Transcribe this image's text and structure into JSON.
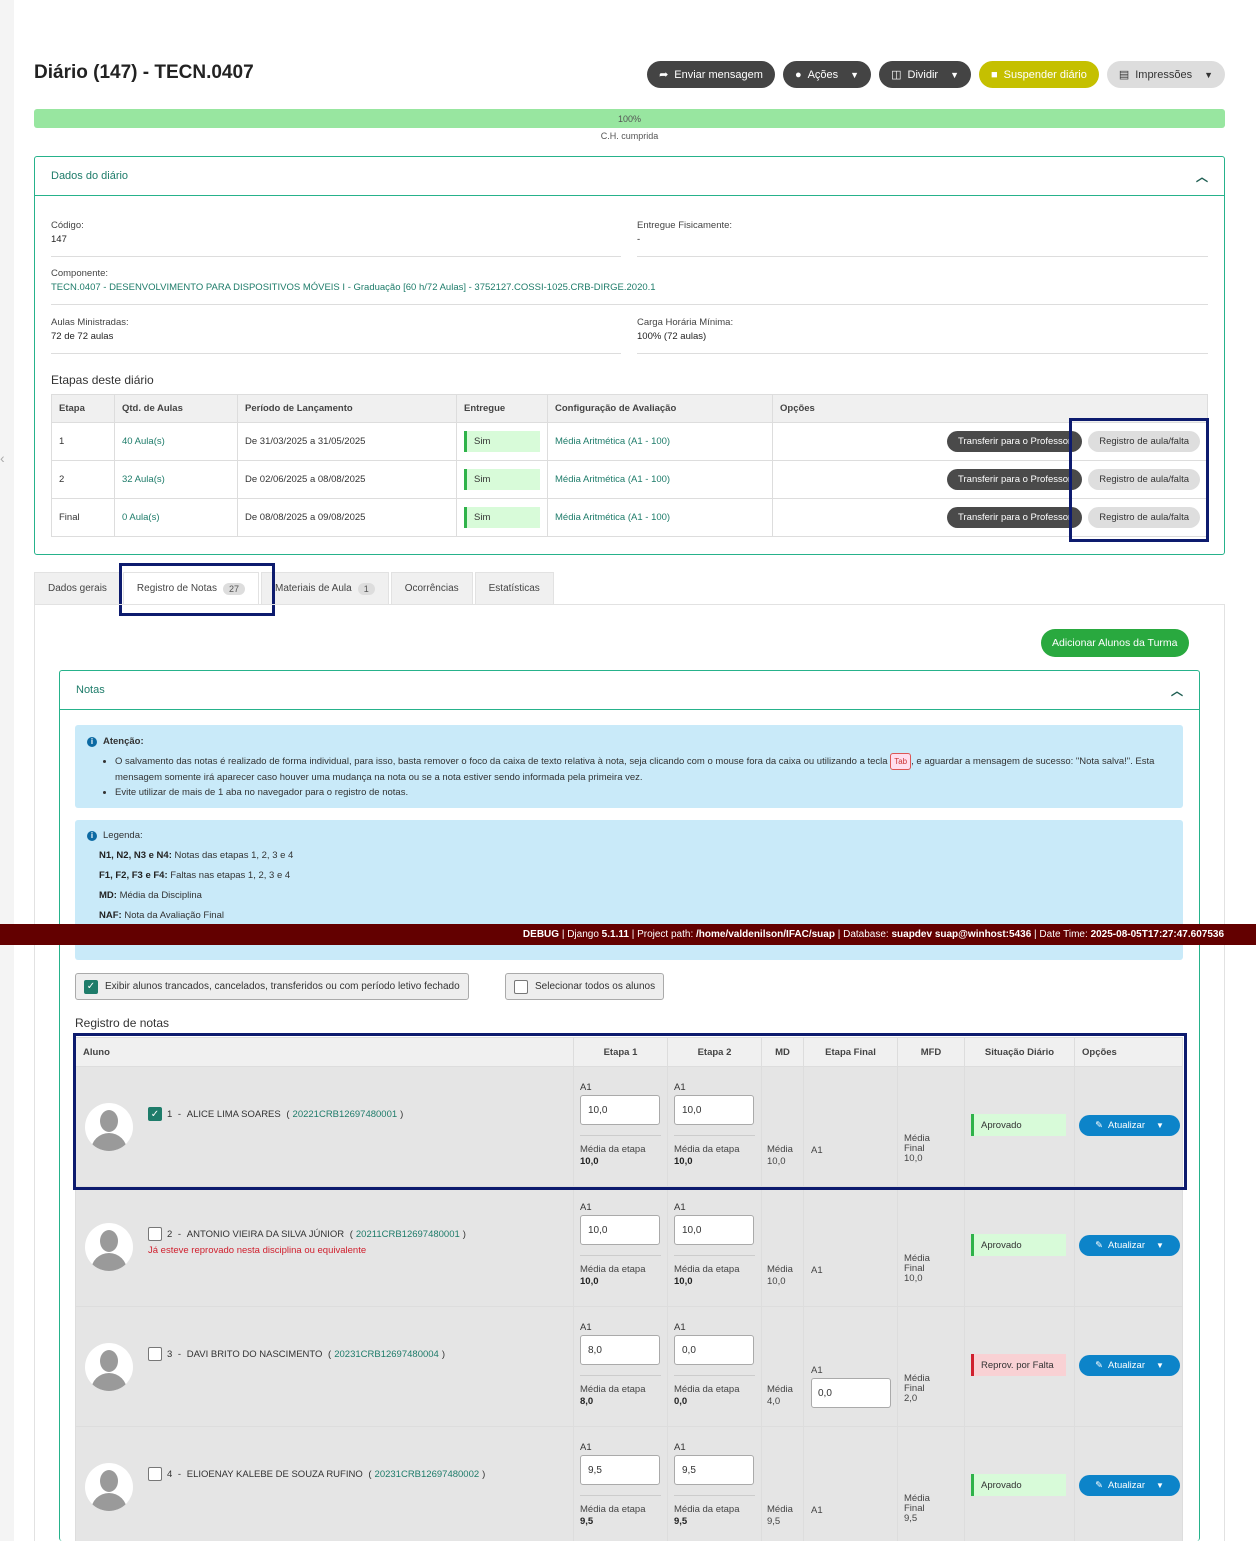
{
  "page_title": "Diário (147) - TECN.0407",
  "actions": {
    "enviar": "Enviar mensagem",
    "acoes": "Ações",
    "dividir": "Dividir",
    "suspender": "Suspender diário",
    "impressoes": "Impressões"
  },
  "progress": {
    "label": "100%",
    "caption": "C.H. cumprida",
    "value": 1.0
  },
  "dados": {
    "header": "Dados do diário",
    "codigo_label": "Código:",
    "codigo": "147",
    "entregue_label": "Entregue Fisicamente:",
    "entregue": "-",
    "componente_label": "Componente:",
    "componente": "TECN.0407 - DESENVOLVIMENTO PARA DISPOSITIVOS MÓVEIS I - Graduação [60 h/72 Aulas] - 3752127.COSSI-1025.CRB-DIRGE.2020.1",
    "aulas_label": "Aulas Ministradas:",
    "aulas": "72 de 72 aulas",
    "carga_label": "Carga Horária Mínima:",
    "carga": "100% (72 aulas)"
  },
  "etapas": {
    "title": "Etapas deste diário",
    "headers": [
      "Etapa",
      "Qtd. de Aulas",
      "Período de Lançamento",
      "Entregue",
      "Configuração de Avaliação",
      "Opções"
    ],
    "btn_transferir": "Transferir para o Professor",
    "btn_registro": "Registro de aula/falta",
    "rows": [
      {
        "etapa": "1",
        "qtd": "40 Aula(s)",
        "periodo": "De 31/03/2025 a 31/05/2025",
        "entregue": "Sim",
        "config": "Média Aritmética (A1 - 100)"
      },
      {
        "etapa": "2",
        "qtd": "32 Aula(s)",
        "periodo": "De 02/06/2025 a 08/08/2025",
        "entregue": "Sim",
        "config": "Média Aritmética (A1 - 100)"
      },
      {
        "etapa": "Final",
        "qtd": "0 Aula(s)",
        "periodo": "De 08/08/2025 a 09/08/2025",
        "entregue": "Sim",
        "config": "Média Aritmética (A1 - 100)"
      }
    ]
  },
  "tabs": [
    {
      "label": "Dados gerais",
      "count": ""
    },
    {
      "label": "Registro de Notas",
      "count": "27"
    },
    {
      "label": "Materiais de Aula",
      "count": "1"
    },
    {
      "label": "Ocorrências",
      "count": ""
    },
    {
      "label": "Estatísticas",
      "count": ""
    }
  ],
  "add_alunos": "Adicionar Alunos da Turma",
  "notas_header": "Notas",
  "atencao": {
    "title": "Atenção:",
    "item1_a": "O salvamento das notas é realizado de forma individual, para isso, basta remover o foco da caixa de texto relativa à nota, seja clicando com o mouse fora da caixa ou utilizando a tecla",
    "tab_key": "Tab",
    "item1_b": ", e aguardar a mensagem de sucesso: \"Nota salva!\". Esta mensagem somente irá aparecer caso houver uma mudança na nota ou se a nota estiver sendo informada pela primeira vez.",
    "item2": "Evite utilizar de mais de 1 aba no navegador para o registro de notas."
  },
  "legenda": {
    "title": "Legenda:",
    "items": [
      {
        "k": "N1, N2, N3 e N4:",
        "v": "Notas das etapas 1, 2, 3 e 4"
      },
      {
        "k": "F1, F2, F3 e F4:",
        "v": "Faltas nas etapas 1, 2, 3 e 4"
      },
      {
        "k": "MD:",
        "v": "Média da Disciplina"
      },
      {
        "k": "NAF:",
        "v": "Nota da Avaliação Final"
      }
    ]
  },
  "debug": {
    "a": "DEBUG",
    "b": " | Django ",
    "c": "5.1.11",
    "d": " | Project path: ",
    "e": "/home/valdenilson/IFAC/suap",
    "f": " | Database: ",
    "g": "suapdev suap@winhost:5436",
    "h": " | Date Time: ",
    "i": "2025-08-05T17:27:47.607536"
  },
  "chk_exibir": "Exibir alunos trancados, cancelados, transferidos ou com período letivo fechado",
  "chk_selecionar": "Selecionar todos os alunos",
  "registro_title": "Registro de notas",
  "notas_headers": [
    "Aluno",
    "Etapa 1",
    "Etapa 2",
    "MD",
    "Etapa Final",
    "MFD",
    "Situação Diário",
    "Opções"
  ],
  "labels": {
    "a1": "A1",
    "media_etapa": "Média da etapa",
    "media": "Média",
    "media_final_1": "Média",
    "media_final_2": "Final",
    "atualizar": "Atualizar"
  },
  "alunos": [
    {
      "num": "1",
      "nome": "ALICE LIMA SOARES",
      "matricula": "20221CRB12697480001",
      "warn": "",
      "checked": true,
      "n1": "10,0",
      "m1": "10,0",
      "n2": "10,0",
      "m2": "10,0",
      "md": "10,0",
      "naf": "",
      "mfd": "10,0",
      "situacao": "Aprovado",
      "ok": true
    },
    {
      "num": "2",
      "nome": "ANTONIO VIEIRA DA SILVA JÚNIOR",
      "matricula": "20211CRB12697480001",
      "warn": "Já esteve reprovado nesta disciplina ou equivalente",
      "checked": false,
      "n1": "10,0",
      "m1": "10,0",
      "n2": "10,0",
      "m2": "10,0",
      "md": "10,0",
      "naf": "",
      "mfd": "10,0",
      "situacao": "Aprovado",
      "ok": true
    },
    {
      "num": "3",
      "nome": "DAVI BRITO DO NASCIMENTO",
      "matricula": "20231CRB12697480004",
      "warn": "",
      "checked": false,
      "n1": "8,0",
      "m1": "8,0",
      "n2": "0,0",
      "m2": "0,0",
      "md": "4,0",
      "naf": "0,0",
      "mfd": "2,0",
      "situacao": "Reprov. por Falta",
      "ok": false
    },
    {
      "num": "4",
      "nome": "ELIOENAY KALEBE DE SOUZA RUFINO",
      "matricula": "20231CRB12697480002",
      "warn": "",
      "checked": false,
      "n1": "9,5",
      "m1": "9,5",
      "n2": "9,5",
      "m2": "9,5",
      "md": "9,5",
      "naf": "",
      "mfd": "9,5",
      "situacao": "Aprovado",
      "ok": true
    }
  ]
}
